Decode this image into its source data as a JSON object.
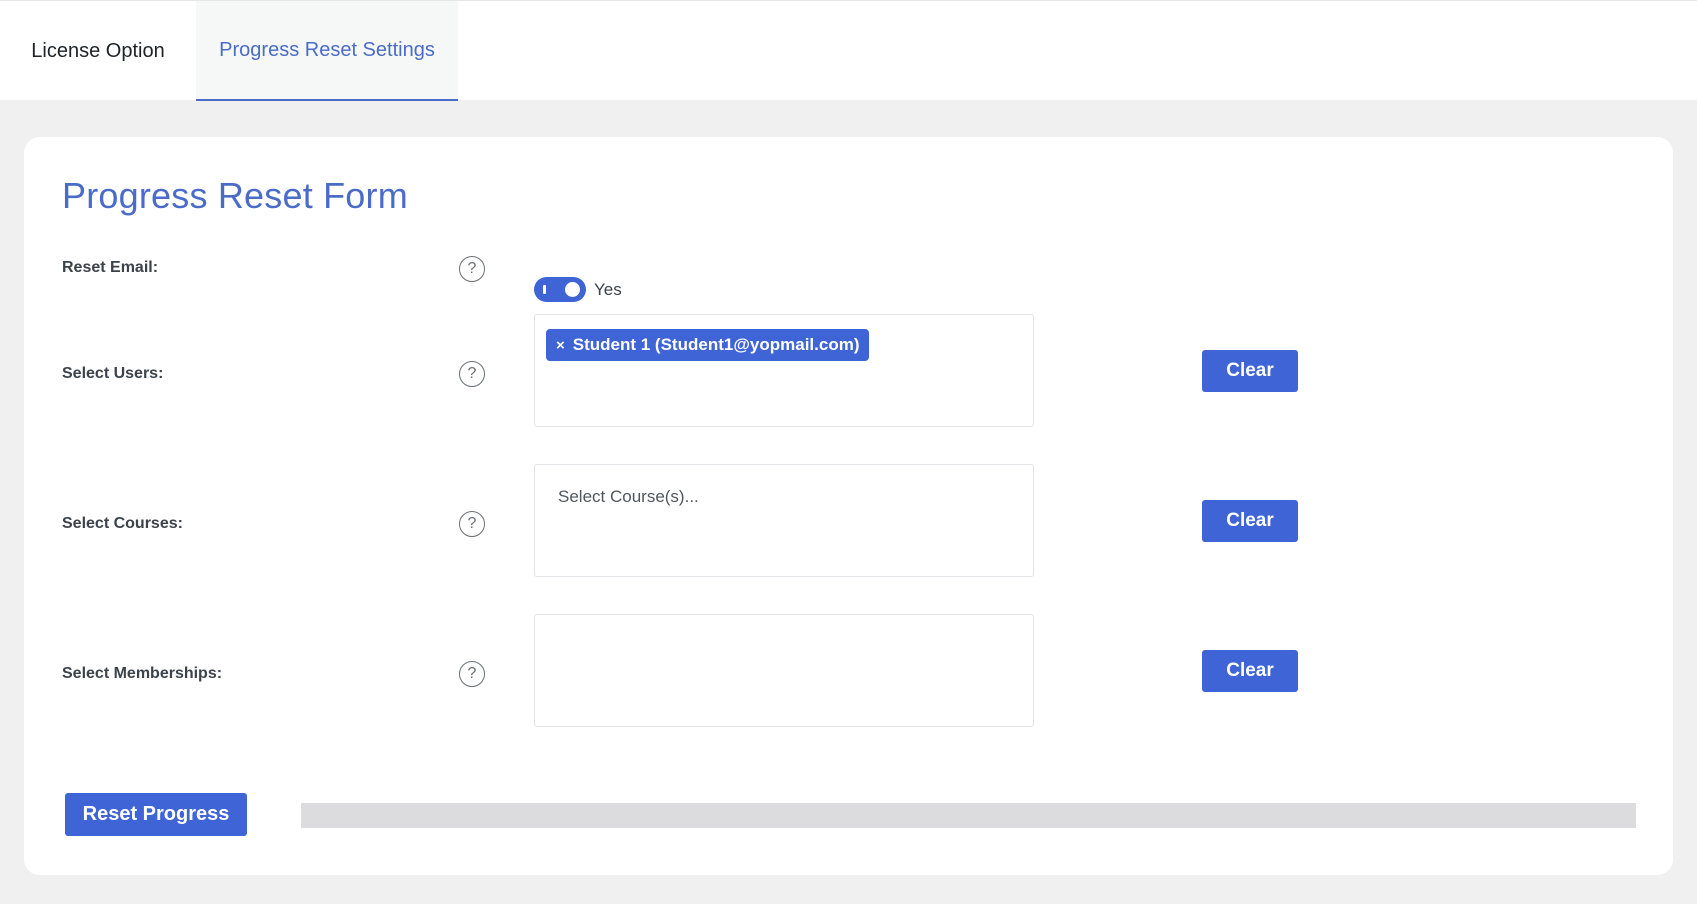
{
  "tabs": [
    {
      "label": "License Option",
      "active": false
    },
    {
      "label": "Progress Reset Settings",
      "active": true
    }
  ],
  "form": {
    "title": "Progress Reset Form",
    "reset_email": {
      "label": "Reset Email:",
      "toggle_on": true,
      "toggle_label": "Yes"
    },
    "users": {
      "label": "Select Users:",
      "selected": [
        {
          "label": "Student 1 (Student1@yopmail.com)",
          "remove": "×"
        }
      ],
      "clear_label": "Clear"
    },
    "courses": {
      "label": "Select Courses:",
      "placeholder": "Select Course(s)...",
      "clear_label": "Clear"
    },
    "memberships": {
      "label": "Select Memberships:",
      "clear_label": "Clear"
    },
    "help_glyph": "?",
    "reset_button": "Reset Progress",
    "progress_fraction": 0
  },
  "colors": {
    "accent": "#3f64d6",
    "title": "#4a6cc8",
    "background": "#f0f0f1",
    "progress_track": "#dcdcde"
  },
  "icons": {
    "help": "question-circle-icon",
    "remove": "close-icon"
  }
}
